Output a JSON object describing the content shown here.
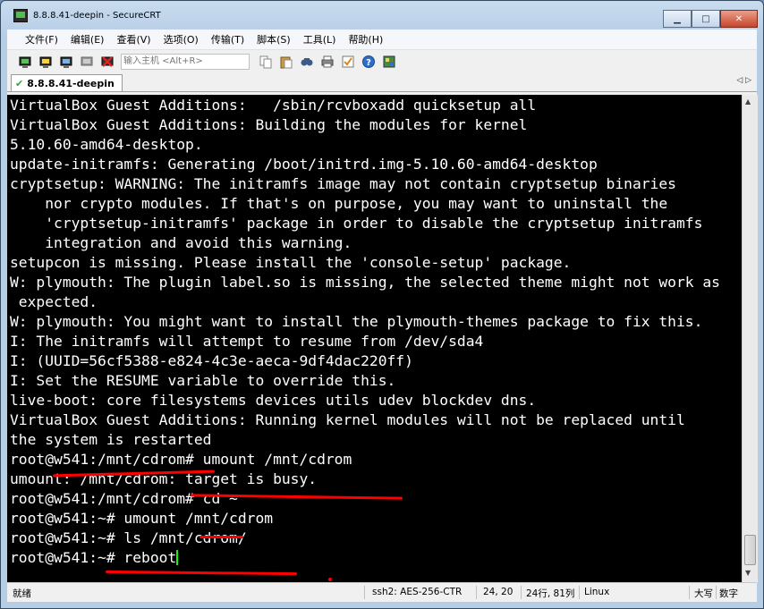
{
  "window": {
    "title": "8.8.8.41-deepin - SecureCRT"
  },
  "window_buttons": {
    "minimize": "▁",
    "maximize": "□",
    "close": "✕"
  },
  "menu": [
    "文件(F)",
    "编辑(E)",
    "查看(V)",
    "选项(O)",
    "传输(T)",
    "脚本(S)",
    "工具(L)",
    "帮助(H)"
  ],
  "toolbar": {
    "host_input_placeholder": "输入主机 <Alt+R>",
    "icons_left": [
      "connect-icon",
      "quick-connect-icon",
      "reconnect-icon",
      "disconnect-icon",
      "disconnect-all-icon"
    ],
    "icons_right": [
      "copy-icon",
      "paste-icon",
      "find-icon",
      "print-icon",
      "options-icon",
      "help-icon",
      "map-icon"
    ]
  },
  "tab": {
    "label": "8.8.8.41-deepin",
    "nav": "◁ ▷"
  },
  "terminal": {
    "lines": [
      "VirtualBox Guest Additions:   /sbin/rcvboxadd quicksetup all",
      "VirtualBox Guest Additions: Building the modules for kernel",
      "5.10.60-amd64-desktop.",
      "update-initramfs: Generating /boot/initrd.img-5.10.60-amd64-desktop",
      "cryptsetup: WARNING: The initramfs image may not contain cryptsetup binaries",
      "    nor crypto modules. If that's on purpose, you may want to uninstall the",
      "    'cryptsetup-initramfs' package in order to disable the cryptsetup initramfs",
      "    integration and avoid this warning.",
      "setupcon is missing. Please install the 'console-setup' package.",
      "W: plymouth: The plugin label.so is missing, the selected theme might not work as",
      " expected.",
      "W: plymouth: You might want to install the plymouth-themes package to fix this.",
      "I: The initramfs will attempt to resume from /dev/sda4",
      "I: (UUID=56cf5388-e824-4c3e-aeca-9df4dac220ff)",
      "I: Set the RESUME variable to override this.",
      "live-boot: core filesystems devices utils udev blockdev dns.",
      "VirtualBox Guest Additions: Running kernel modules will not be replaced until",
      "the system is restarted",
      "root@w541:/mnt/cdrom# umount /mnt/cdrom",
      "umount: /mnt/cdrom: target is busy.",
      "root@w541:/mnt/cdrom# cd ~",
      "root@w541:~# umount /mnt/cdrom",
      "root@w541:~# ls /mnt/cdrom/",
      "root@w541:~# reboot"
    ]
  },
  "status": {
    "ready": "就绪",
    "cipher": "ssh2: AES-256-CTR",
    "cursor_pos": "24, 20",
    "size": "24行, 81列",
    "os": "Linux",
    "caps": "大写",
    "num": "数字"
  }
}
